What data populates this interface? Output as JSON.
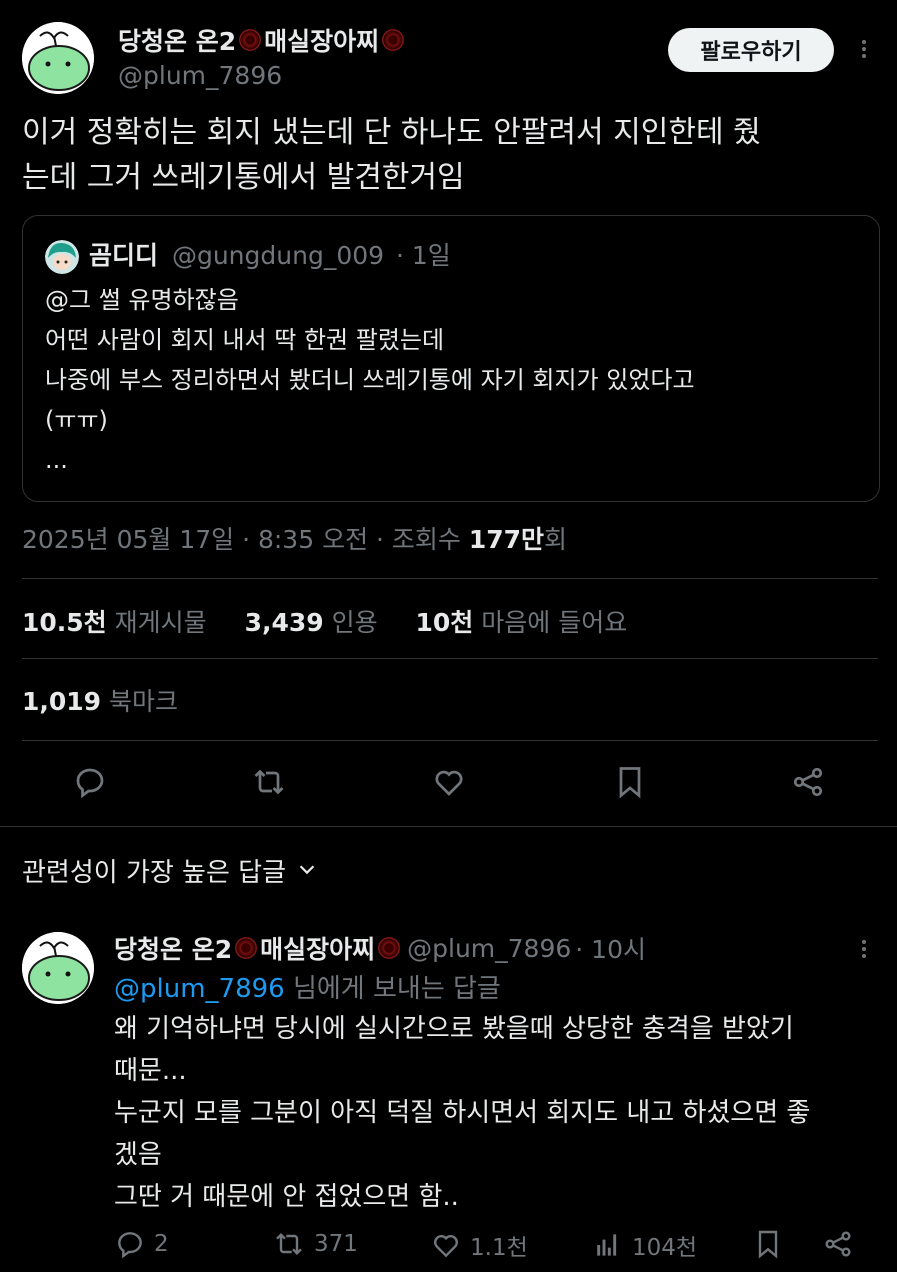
{
  "post": {
    "author_name": "당청온 온2",
    "author_name_suffix": "매실장아찌",
    "author_handle": "@plum_7896",
    "follow_label": "팔로우하기",
    "text_line1": "이거 정확히는 회지 냈는데 단 하나도 안팔려서 지인한테 줬",
    "text_line2": "는데 그거 쓰레기통에서 발견한거임",
    "quote": {
      "author_name": "곰디디",
      "author_handle": "@gungdung_009",
      "time": "· 1일",
      "lines": [
        "@그 썰 유명하잖음",
        "어떤 사람이 회지 내서 딱 한권 팔렸는데",
        "나중에 부스 정리하면서 봤더니 쓰레기통에 자기 회지가 있었다고",
        "(ㅠㅠ)",
        "..."
      ]
    },
    "meta": {
      "date": "2025년 05월 17일 · 8:35 오전 · 조회수 ",
      "views_number": "177만",
      "views_suffix": "회"
    },
    "stats": {
      "reposts_num": "10.5천",
      "reposts_label": "재게시물",
      "quotes_num": "3,439",
      "quotes_label": "인용",
      "likes_num": "10천",
      "likes_label": "마음에 들어요",
      "bookmarks_num": "1,019",
      "bookmarks_label": "북마크"
    }
  },
  "sort": {
    "label": "관련성이 가장 높은 답글"
  },
  "reply": {
    "author_name": "당청온 온2",
    "author_name_suffix": "매실장아찌",
    "author_handle": "@plum_7896",
    "time": "· 10시",
    "replying_to_handle": "@plum_7896",
    "replying_to_suffix": " 님에게 보내는 답글",
    "lines": [
      "왜 기억하냐면 당시에 실시간으로 봤을때 상당한 충격을 받았기",
      "때문...",
      "누군지 모를 그분이 아직 덕질 하시면서 회지도 내고 하셨으면 좋",
      "겠음",
      "그딴 거 때문에 안 접었으면 함.."
    ],
    "actions": {
      "replies": "2",
      "reposts": "371",
      "likes": "1.1천",
      "views": "104천"
    }
  },
  "colors": {
    "background": "#000000",
    "text": "#e7e9ea",
    "muted": "#71767b",
    "link": "#1d9bf0",
    "divider": "#2f3336"
  },
  "icons": [
    "reply-icon",
    "repost-icon",
    "like-icon",
    "bookmark-icon",
    "share-icon",
    "more-icon",
    "views-icon",
    "chevron-down-icon"
  ]
}
